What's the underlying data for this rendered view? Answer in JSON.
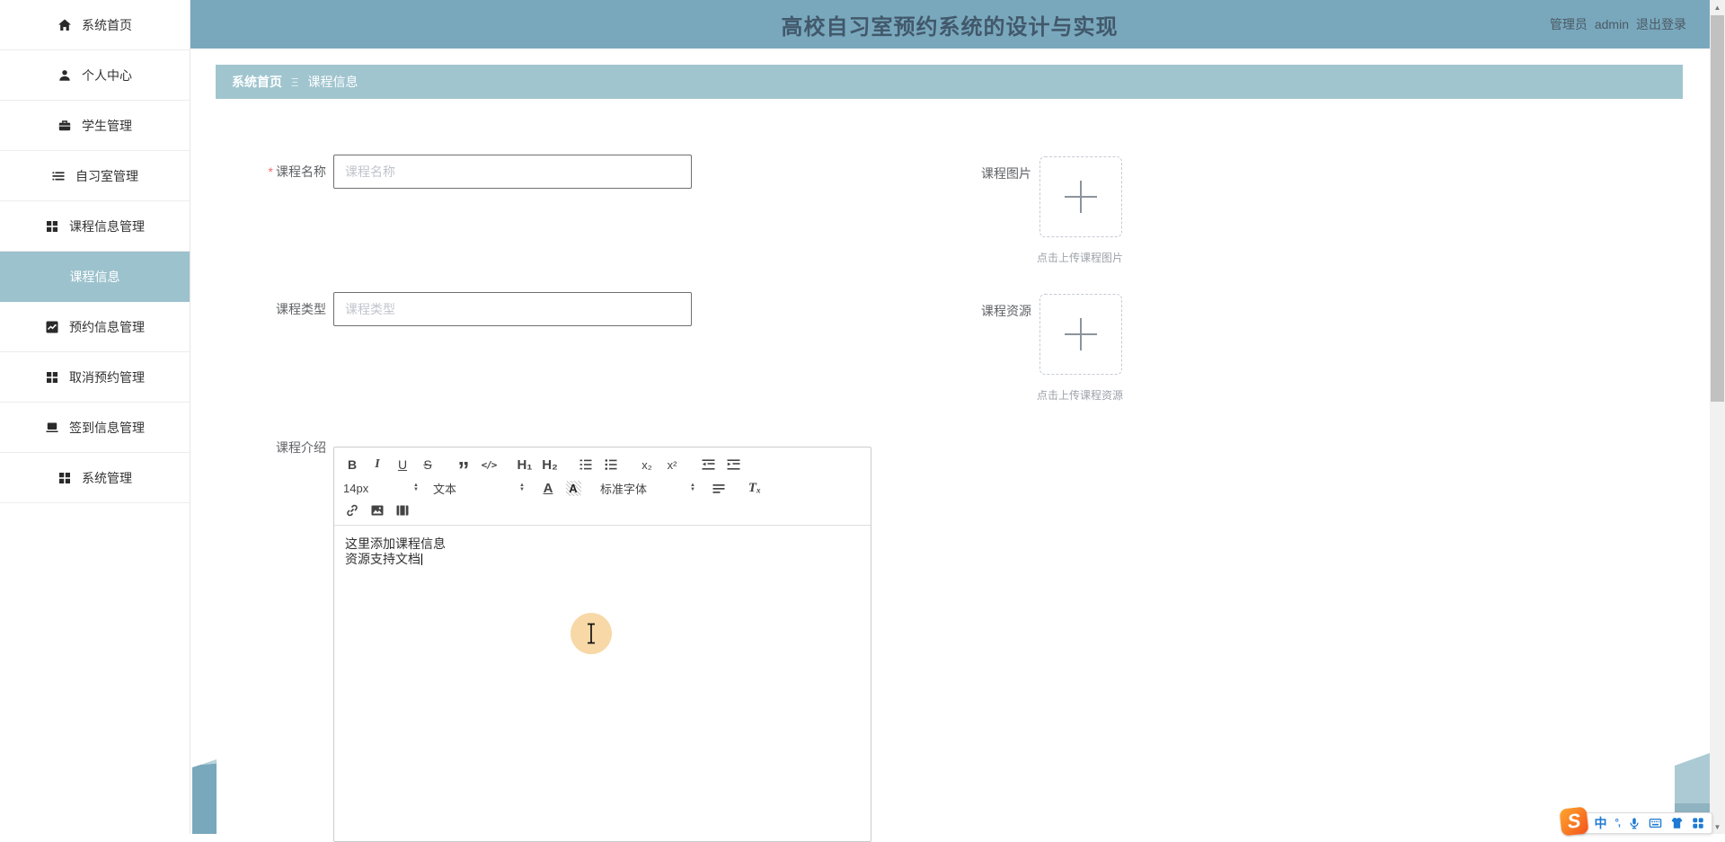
{
  "header": {
    "title": "高校自习室预约系统的设计与实现",
    "admin_role": "管理员",
    "admin_name": "admin",
    "logout_label": "退出登录"
  },
  "sidebar": {
    "items": [
      {
        "label": "系统首页",
        "icon": "home-icon",
        "active": false
      },
      {
        "label": "个人中心",
        "icon": "user-icon",
        "active": false
      },
      {
        "label": "学生管理",
        "icon": "briefcase-icon",
        "active": false
      },
      {
        "label": "自习室管理",
        "icon": "list-icon",
        "active": false
      },
      {
        "label": "课程信息管理",
        "icon": "grid-icon",
        "active": false
      },
      {
        "label": "课程信息",
        "icon": "none",
        "active": true
      },
      {
        "label": "预约信息管理",
        "icon": "chart-icon",
        "active": false
      },
      {
        "label": "取消预约管理",
        "icon": "grid-icon",
        "active": false
      },
      {
        "label": "签到信息管理",
        "icon": "monitor-icon",
        "active": false
      },
      {
        "label": "系统管理",
        "icon": "grid-icon",
        "active": false
      }
    ]
  },
  "breadcrumb": {
    "home": "系统首页",
    "separator": "Ξ",
    "current": "课程信息"
  },
  "form": {
    "required_mark": "*",
    "course_name": {
      "label": "课程名称",
      "placeholder": "课程名称",
      "value": ""
    },
    "course_type": {
      "label": "课程类型",
      "placeholder": "课程类型",
      "value": ""
    },
    "course_image": {
      "label": "课程图片",
      "hint": "点击上传课程图片"
    },
    "course_resource": {
      "label": "课程资源",
      "hint": "点击上传课程资源"
    },
    "course_intro": {
      "label": "课程介绍",
      "lines": [
        "这里添加课程信息",
        "资源支持文档"
      ]
    }
  },
  "editor": {
    "toolbar": {
      "bold": "B",
      "italic": "I",
      "underline": "U",
      "strike": "S",
      "quote": "”",
      "code": "</>",
      "h1": "H₁",
      "h2": "H₂",
      "subscript": "x₂",
      "superscript": "x²",
      "font_size": "14px",
      "paragraph": "文本",
      "font_color": "A",
      "bg_color": "A",
      "font_family": "标准字体",
      "clear_format": "Tₓ"
    }
  },
  "ime_bar": {
    "logo": "S",
    "lang": "中",
    "punct": "°,"
  },
  "glyphs": {
    "spinner_up": "▲",
    "spinner_down": "▼",
    "scroll_up": "▲",
    "scroll_down": "▼"
  },
  "colors": {
    "header_bg": "#79a8bd",
    "breadcrumb_bg": "#a0c5cf",
    "active_item_bg": "#9cc2cd",
    "title_text": "#42586b",
    "input_border": "#6e6e6e",
    "placeholder_text": "#c0c4cc",
    "required_mark": "#f56c6c",
    "hint_text": "#9da3ab",
    "editor_border": "#cccccc",
    "ime_blue": "#1e7ad3",
    "cursor_halo": "#f6d59e"
  }
}
